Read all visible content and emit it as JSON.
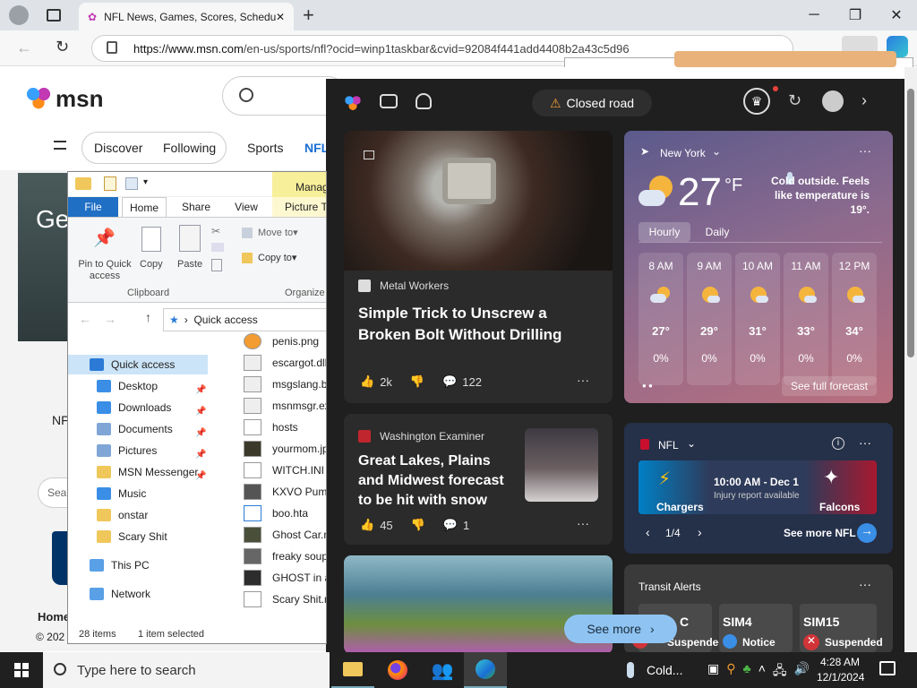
{
  "browser": {
    "tab_title": "NFL News, Games, Scores, Schedule",
    "url_host": "https://www.msn.com",
    "url_rest": "/en-us/sports/nfl?ocid=winp1taskbar&cvid=92084f441add4408b2a43c5d96",
    "new_tab": "+",
    "min": "─",
    "max": "❐",
    "close": "✕"
  },
  "msn": {
    "logo_text": "msn",
    "nav": [
      "Discover",
      "Following",
      "Sports",
      "NFL"
    ],
    "search_placeholder": "Sea",
    "left_fragments": {
      "ge": "Ge",
      "nf": "NF",
      "home": "Home",
      "copyright": "© 202"
    }
  },
  "widgets": {
    "status_pill": "Closed road",
    "news1": {
      "source": "Metal Workers",
      "headline": "Simple Trick to Unscrew a Broken Bolt Without Drilling",
      "likes": "2k",
      "comments": "122"
    },
    "news2": {
      "source": "Washington Examiner",
      "headline": "Great Lakes, Plains and Midwest forecast to be hit with snow and...",
      "likes": "45",
      "comments": "1"
    },
    "weather": {
      "location": "New York",
      "temp": "27",
      "unit": "°F",
      "alert": "Cold outside. Feels like temperature is 19°.",
      "tabs": [
        "Hourly",
        "Daily"
      ],
      "hours": [
        {
          "time": "8 AM",
          "temp": "27°",
          "precip": "0%"
        },
        {
          "time": "9 AM",
          "temp": "29°",
          "precip": "0%"
        },
        {
          "time": "10 AM",
          "temp": "31°",
          "precip": "0%"
        },
        {
          "time": "11 AM",
          "temp": "33°",
          "precip": "0%"
        },
        {
          "time": "12 PM",
          "temp": "34°",
          "precip": "0%"
        }
      ],
      "forecast_link": "See full forecast"
    },
    "nfl": {
      "title": "NFL",
      "game_time": "10:00 AM - Dec 1",
      "game_note": "Injury report available",
      "team1": "Chargers",
      "team2": "Falcons",
      "pager": "1/4",
      "see_more": "See more NFL"
    },
    "transit": {
      "title": "Transit Alerts",
      "items": [
        {
          "code": "C",
          "status": "Suspended"
        },
        {
          "code": "SIM4",
          "status": "Notice"
        },
        {
          "code": "SIM15",
          "status": "Suspended"
        }
      ]
    },
    "see_more": "See more",
    "more": "···"
  },
  "explorer": {
    "tabs": [
      "File",
      "Home",
      "Share",
      "View",
      "Picture Tools"
    ],
    "manage": "Manage",
    "ribbon": {
      "pin": "Pin to Quick access",
      "copy": "Copy",
      "paste": "Paste",
      "move_to": "Move to",
      "copy_to": "Copy to",
      "clipboard": "Clipboard",
      "organize": "Organize"
    },
    "path": "Quick access",
    "nav": [
      {
        "label": "Quick access",
        "color": "#2b7bd6",
        "selected": true
      },
      {
        "label": "Desktop",
        "color": "#3a8ee6"
      },
      {
        "label": "Downloads",
        "color": "#3a8ee6"
      },
      {
        "label": "Documents",
        "color": "#7fa6d6"
      },
      {
        "label": "Pictures",
        "color": "#7fa6d6"
      },
      {
        "label": "MSN Messenger",
        "color": "#f0c75a"
      },
      {
        "label": "Music",
        "color": "#3a8ee6"
      },
      {
        "label": "onstar",
        "color": "#f0c75a"
      },
      {
        "label": "Scary Shit",
        "color": "#f0c75a"
      },
      {
        "label": "This PC",
        "color": "#5aa0e6"
      },
      {
        "label": "Network",
        "color": "#5aa0e6"
      }
    ],
    "files": [
      "penis.png",
      "escargot.dll",
      "msgslang.b",
      "msnmsgr.ex",
      "hosts",
      "yourmom.jp",
      "WITCH.INI",
      "KXVO Pump",
      "boo.hta",
      "Ghost Car.n",
      "freaky soup",
      "GHOST in a",
      "Scary Shit.m"
    ],
    "item_count": "28 items",
    "selected": "1 item selected"
  },
  "taskbar": {
    "search_placeholder": "Type here to search",
    "weather": "Cold...",
    "time": "4:28 AM",
    "date": "12/1/2024"
  }
}
